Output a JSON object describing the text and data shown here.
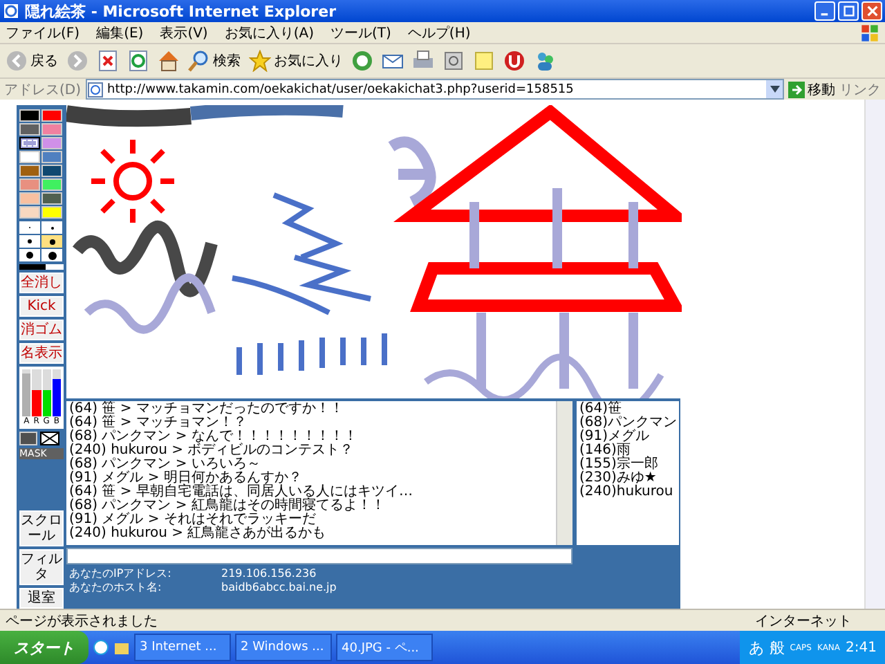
{
  "window": {
    "title": "隠れ絵茶 - Microsoft Internet Explorer"
  },
  "menu": [
    "ファイル(F)",
    "編集(E)",
    "表示(V)",
    "お気に入り(A)",
    "ツール(T)",
    "ヘルプ(H)"
  ],
  "toolbar": {
    "back": "戻る",
    "search": "検索",
    "favorites": "お気に入り"
  },
  "address": {
    "label": "アドレス(D)",
    "value": "http://www.takamin.com/oekakichat/user/oekakichat3.php?userid=158515",
    "go": "移動",
    "links": "リンク"
  },
  "palette": {
    "colors": [
      {
        "color": "#000000",
        "selected": false
      },
      {
        "color": "#ff0000",
        "selected": false
      },
      {
        "color": "#606060",
        "selected": false
      },
      {
        "color": "#f080a0",
        "selected": false
      },
      {
        "color": "#a0a0d8",
        "selected": true
      },
      {
        "color": "#d090e8",
        "selected": false
      },
      {
        "color": "#ffffff",
        "selected": false
      },
      {
        "color": "#5080c0",
        "selected": false
      },
      {
        "color": "#a06010",
        "selected": false
      },
      {
        "color": "#104870",
        "selected": false
      },
      {
        "color": "#e89080",
        "selected": false
      },
      {
        "color": "#40f060",
        "selected": false
      },
      {
        "color": "#f8c0a0",
        "selected": false
      },
      {
        "color": "#506050",
        "selected": false
      },
      {
        "color": "#f8d8c0",
        "selected": false
      },
      {
        "color": "#ffff00",
        "selected": false
      }
    ],
    "brushes": [
      {
        "selected": false
      },
      {
        "selected": false
      },
      {
        "selected": false
      },
      {
        "selected": true
      },
      {
        "selected": false
      },
      {
        "selected": false
      }
    ],
    "tools": [
      "全消し",
      "Kick",
      "消ゴム",
      "名表示"
    ],
    "meter": [
      {
        "name": "A",
        "level": 0.9,
        "color": "#b0b0b0"
      },
      {
        "name": "R",
        "level": 0.55,
        "color": "#ff0000"
      },
      {
        "name": "G",
        "level": 0.55,
        "color": "#00e000"
      },
      {
        "name": "B",
        "level": 0.8,
        "color": "#0000ff"
      }
    ],
    "mask": "MASK",
    "buttons": [
      "スクロール",
      "フィルタ",
      "退室"
    ]
  },
  "chat": {
    "lines": [
      "(64) 笹 > マッチョマンだったのですか！！",
      "(64) 笹 > マッチョマン！？",
      "(68) パンクマン > なんで！！！！！！！！！",
      "(240) hukurou > ボディビルのコンテスト？",
      "(68) パンクマン > いろいろ～",
      "(91) メグル > 明日何かあるんすか？",
      "(64) 笹 > 早朝自宅電話は、同居人いる人にはキツイ…",
      "(68) パンクマン > 紅鳥龍はその時間寝てるよ！！",
      "(91) メグル > それはそれでラッキーだ",
      "(240) hukurou > 紅鳥龍さあが出るかも"
    ]
  },
  "users": [
    "(64)笹",
    "(68)パンクマン",
    "(91)メグル",
    "(146)雨",
    "(155)宗一郎",
    "(230)みゆ★",
    "(240)hukurou"
  ],
  "info": [
    {
      "label": "あなたのIPアドレス:",
      "value": "219.106.156.236"
    },
    {
      "label": "あなたのホスト名:",
      "value": "baidb6abcc.bai.ne.jp"
    }
  ],
  "status_bar": {
    "text": "ページが表示されました",
    "zone": "インターネット"
  },
  "taskbar": {
    "start": "スタート",
    "tasks": [
      "3 Internet ...",
      "2 Windows ...",
      "40.JPG - ペ..."
    ],
    "ime": [
      "あ",
      "般"
    ],
    "keys": [
      "CAPS",
      "KANA"
    ],
    "clock": "2:41"
  }
}
